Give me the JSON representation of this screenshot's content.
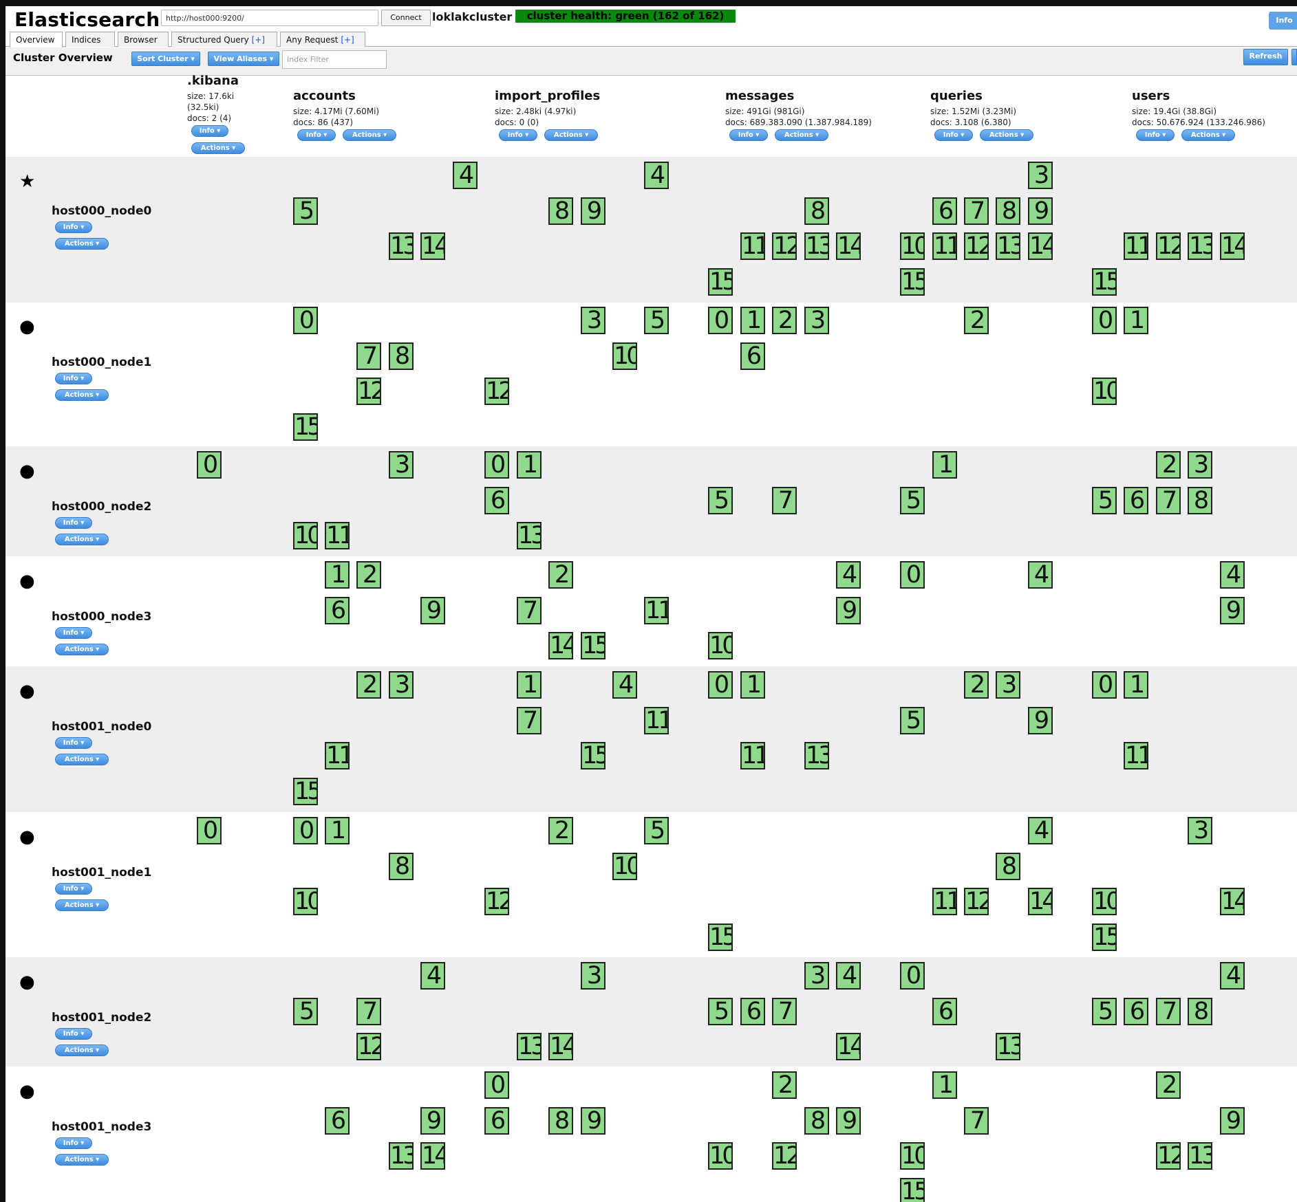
{
  "header": {
    "brand": "Elasticsearch",
    "url_value": "http://host000:9200/",
    "connect_label": "Connect",
    "cluster_name": "loklakcluster",
    "health": "cluster health: green (162 of 162)",
    "info_label": "Info"
  },
  "tabs": [
    {
      "label": "Overview",
      "plus": ""
    },
    {
      "label": "Indices",
      "plus": ""
    },
    {
      "label": "Browser",
      "plus": ""
    },
    {
      "label": "Structured Query",
      "plus": "[+]"
    },
    {
      "label": "Any Request",
      "plus": "[+]"
    }
  ],
  "toolbar": {
    "title": "Cluster Overview",
    "sort_label": "Sort Cluster ▾",
    "aliases_label": "View Aliases ▾",
    "filter_placeholder": "Index Filter",
    "refresh_label": "Refresh"
  },
  "buttons": {
    "info": "Info ▾",
    "actions": "Actions ▾"
  },
  "indices": [
    {
      "name": ".kibana",
      "size": "size: 17.6ki",
      "size2": "(32.5ki)",
      "docs": "docs: 2 (4)"
    },
    {
      "name": "accounts",
      "size": "size: 4.17Mi (7.60Mi)",
      "size2": "",
      "docs": "docs: 86 (437)"
    },
    {
      "name": "import_profiles",
      "size": "size: 2.48ki (4.97ki)",
      "size2": "",
      "docs": "docs: 0 (0)"
    },
    {
      "name": "messages",
      "size": "size: 491Gi (981Gi)",
      "size2": "",
      "docs": "docs: 689.383.090 (1.387.984.189)"
    },
    {
      "name": "queries",
      "size": "size: 1.52Mi (3.23Mi)",
      "size2": "",
      "docs": "docs: 3.108 (6.380)"
    },
    {
      "name": "users",
      "size": "size: 19.4Gi (38.8Gi)",
      "size2": "",
      "docs": "docs: 50.676.924 (133.246.986)"
    }
  ],
  "nodes": [
    {
      "name": "host000_node0",
      "marker": "★",
      "shards": [
        [
          14,
          0,
          "4"
        ],
        [
          20,
          0,
          "4"
        ],
        [
          32,
          0,
          "3"
        ],
        [
          9,
          1,
          "5"
        ],
        [
          17,
          1,
          "8"
        ],
        [
          18,
          1,
          "9"
        ],
        [
          25,
          1,
          "8"
        ],
        [
          29,
          1,
          "6"
        ],
        [
          30,
          1,
          "7"
        ],
        [
          31,
          1,
          "8"
        ],
        [
          32,
          1,
          "9"
        ],
        [
          12,
          2,
          "13"
        ],
        [
          13,
          2,
          "14"
        ],
        [
          23,
          2,
          "11"
        ],
        [
          24,
          2,
          "12"
        ],
        [
          25,
          2,
          "13"
        ],
        [
          26,
          2,
          "14"
        ],
        [
          28,
          2,
          "10"
        ],
        [
          29,
          2,
          "11"
        ],
        [
          30,
          2,
          "12"
        ],
        [
          31,
          2,
          "13"
        ],
        [
          32,
          2,
          "14"
        ],
        [
          35,
          2,
          "11"
        ],
        [
          36,
          2,
          "12"
        ],
        [
          37,
          2,
          "13"
        ],
        [
          38,
          2,
          "14"
        ],
        [
          22,
          3,
          "15"
        ],
        [
          28,
          3,
          "15"
        ],
        [
          34,
          3,
          "15"
        ]
      ]
    },
    {
      "name": "host000_node1",
      "marker": "●",
      "shards": [
        [
          9,
          0,
          "0"
        ],
        [
          18,
          0,
          "3"
        ],
        [
          20,
          0,
          "5"
        ],
        [
          22,
          0,
          "0"
        ],
        [
          23,
          0,
          "1"
        ],
        [
          24,
          0,
          "2"
        ],
        [
          25,
          0,
          "3"
        ],
        [
          30,
          0,
          "2"
        ],
        [
          34,
          0,
          "0"
        ],
        [
          35,
          0,
          "1"
        ],
        [
          11,
          1,
          "7"
        ],
        [
          12,
          1,
          "8"
        ],
        [
          19,
          1,
          "10"
        ],
        [
          23,
          1,
          "6"
        ],
        [
          11,
          2,
          "12"
        ],
        [
          15,
          2,
          "12"
        ],
        [
          34,
          2,
          "10"
        ],
        [
          9,
          3,
          "15"
        ]
      ]
    },
    {
      "name": "host000_node2",
      "marker": "●",
      "shards": [
        [
          6,
          0,
          "0"
        ],
        [
          12,
          0,
          "3"
        ],
        [
          15,
          0,
          "0"
        ],
        [
          16,
          0,
          "1"
        ],
        [
          29,
          0,
          "1"
        ],
        [
          36,
          0,
          "2"
        ],
        [
          37,
          0,
          "3"
        ],
        [
          15,
          1,
          "6"
        ],
        [
          22,
          1,
          "5"
        ],
        [
          24,
          1,
          "7"
        ],
        [
          28,
          1,
          "5"
        ],
        [
          34,
          1,
          "5"
        ],
        [
          35,
          1,
          "6"
        ],
        [
          36,
          1,
          "7"
        ],
        [
          37,
          1,
          "8"
        ],
        [
          9,
          2,
          "10"
        ],
        [
          10,
          2,
          "11"
        ],
        [
          16,
          2,
          "13"
        ]
      ]
    },
    {
      "name": "host000_node3",
      "marker": "●",
      "shards": [
        [
          10,
          0,
          "1"
        ],
        [
          11,
          0,
          "2"
        ],
        [
          17,
          0,
          "2"
        ],
        [
          26,
          0,
          "4"
        ],
        [
          28,
          0,
          "0"
        ],
        [
          32,
          0,
          "4"
        ],
        [
          38,
          0,
          "4"
        ],
        [
          10,
          1,
          "6"
        ],
        [
          13,
          1,
          "9"
        ],
        [
          16,
          1,
          "7"
        ],
        [
          20,
          1,
          "11"
        ],
        [
          26,
          1,
          "9"
        ],
        [
          38,
          1,
          "9"
        ],
        [
          17,
          2,
          "14"
        ],
        [
          18,
          2,
          "15"
        ],
        [
          22,
          2,
          "10"
        ]
      ]
    },
    {
      "name": "host001_node0",
      "marker": "●",
      "shards": [
        [
          11,
          0,
          "2"
        ],
        [
          12,
          0,
          "3"
        ],
        [
          16,
          0,
          "1"
        ],
        [
          19,
          0,
          "4"
        ],
        [
          22,
          0,
          "0"
        ],
        [
          23,
          0,
          "1"
        ],
        [
          30,
          0,
          "2"
        ],
        [
          31,
          0,
          "3"
        ],
        [
          34,
          0,
          "0"
        ],
        [
          35,
          0,
          "1"
        ],
        [
          16,
          1,
          "7"
        ],
        [
          20,
          1,
          "11"
        ],
        [
          28,
          1,
          "5"
        ],
        [
          32,
          1,
          "9"
        ],
        [
          10,
          2,
          "11"
        ],
        [
          18,
          2,
          "15"
        ],
        [
          23,
          2,
          "11"
        ],
        [
          25,
          2,
          "13"
        ],
        [
          35,
          2,
          "11"
        ],
        [
          9,
          3,
          "15"
        ]
      ]
    },
    {
      "name": "host001_node1",
      "marker": "●",
      "shards": [
        [
          6,
          0,
          "0"
        ],
        [
          9,
          0,
          "0"
        ],
        [
          10,
          0,
          "1"
        ],
        [
          17,
          0,
          "2"
        ],
        [
          20,
          0,
          "5"
        ],
        [
          32,
          0,
          "4"
        ],
        [
          37,
          0,
          "3"
        ],
        [
          12,
          1,
          "8"
        ],
        [
          19,
          1,
          "10"
        ],
        [
          31,
          1,
          "8"
        ],
        [
          9,
          2,
          "10"
        ],
        [
          15,
          2,
          "12"
        ],
        [
          29,
          2,
          "11"
        ],
        [
          30,
          2,
          "12"
        ],
        [
          32,
          2,
          "14"
        ],
        [
          34,
          2,
          "10"
        ],
        [
          38,
          2,
          "14"
        ],
        [
          22,
          3,
          "15"
        ],
        [
          34,
          3,
          "15"
        ]
      ]
    },
    {
      "name": "host001_node2",
      "marker": "●",
      "shards": [
        [
          13,
          0,
          "4"
        ],
        [
          18,
          0,
          "3"
        ],
        [
          25,
          0,
          "3"
        ],
        [
          26,
          0,
          "4"
        ],
        [
          28,
          0,
          "0"
        ],
        [
          38,
          0,
          "4"
        ],
        [
          9,
          1,
          "5"
        ],
        [
          11,
          1,
          "7"
        ],
        [
          22,
          1,
          "5"
        ],
        [
          23,
          1,
          "6"
        ],
        [
          24,
          1,
          "7"
        ],
        [
          29,
          1,
          "6"
        ],
        [
          34,
          1,
          "5"
        ],
        [
          35,
          1,
          "6"
        ],
        [
          36,
          1,
          "7"
        ],
        [
          37,
          1,
          "8"
        ],
        [
          11,
          2,
          "12"
        ],
        [
          16,
          2,
          "13"
        ],
        [
          17,
          2,
          "14"
        ],
        [
          26,
          2,
          "14"
        ],
        [
          31,
          2,
          "13"
        ]
      ]
    },
    {
      "name": "host001_node3",
      "marker": "●",
      "shards": [
        [
          15,
          0,
          "0"
        ],
        [
          24,
          0,
          "2"
        ],
        [
          29,
          0,
          "1"
        ],
        [
          36,
          0,
          "2"
        ],
        [
          10,
          1,
          "6"
        ],
        [
          13,
          1,
          "9"
        ],
        [
          15,
          1,
          "6"
        ],
        [
          17,
          1,
          "8"
        ],
        [
          18,
          1,
          "9"
        ],
        [
          25,
          1,
          "8"
        ],
        [
          26,
          1,
          "9"
        ],
        [
          30,
          1,
          "7"
        ],
        [
          38,
          1,
          "9"
        ],
        [
          12,
          2,
          "13"
        ],
        [
          13,
          2,
          "14"
        ],
        [
          22,
          2,
          "10"
        ],
        [
          24,
          2,
          "12"
        ],
        [
          28,
          2,
          "10"
        ],
        [
          36,
          2,
          "12"
        ],
        [
          37,
          2,
          "13"
        ],
        [
          28,
          3,
          "15"
        ]
      ]
    }
  ]
}
